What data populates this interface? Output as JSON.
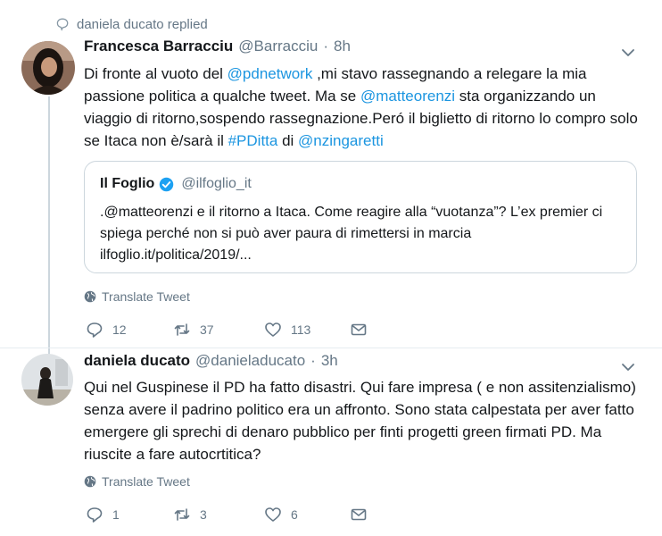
{
  "reply_context": {
    "text": "daniela ducato replied"
  },
  "tweets": [
    {
      "name": "Francesca Barracciu",
      "handle": "@Barracciu",
      "dot": "·",
      "time": "8h",
      "text": {
        "s1": "Di fronte al vuoto del ",
        "l1": "@pdnetwork",
        "s2": " ,mi stavo rassegnando a relegare la mia passione politica a qualche tweet. Ma se ",
        "l2": "@matteorenzi",
        "s3": " sta organizzando un viaggio di ritorno,sospendo rassegnazione.Peró il biglietto di ritorno lo compro solo se Itaca non è/sarà il ",
        "l3": "#PDitta",
        "s4": " di ",
        "l4": "@nzingaretti"
      },
      "quote": {
        "name": "Il Foglio",
        "handle": "@ilfoglio_it",
        "text": ".@matteorenzi e il ritorno a Itaca. Come reagire alla “vuotanza”? L’ex premier ci spiega perché non si può aver paura di rimettersi in marcia ilfoglio.it/politica/2019/..."
      },
      "translate": "Translate Tweet",
      "replies": "12",
      "retweets": "37",
      "likes": "113"
    },
    {
      "name": "daniela ducato",
      "handle": "@danieladucato",
      "dot": "·",
      "time": "3h",
      "text": "Qui nel Guspinese il PD ha fatto disastri. Qui fare impresa ( e non assitenzialismo) senza avere il padrino politico era un affronto. Sono stata calpestata per aver fatto emergere gli sprechi di denaro pubblico per finti progetti green firmati PD. Ma riuscite a fare autocrtitica?",
      "translate": "Translate Tweet",
      "replies": "1",
      "retweets": "3",
      "likes": "6"
    }
  ],
  "colors": {
    "link": "#1b95e0",
    "secondary": "#657786",
    "verified": "#1da1f2",
    "border": "#ccd6dd"
  },
  "icons": [
    "speech-bubble-icon",
    "chevron-down-icon",
    "verified-badge-icon",
    "globe-icon",
    "reply-icon",
    "retweet-icon",
    "like-icon",
    "share-mail-icon"
  ]
}
